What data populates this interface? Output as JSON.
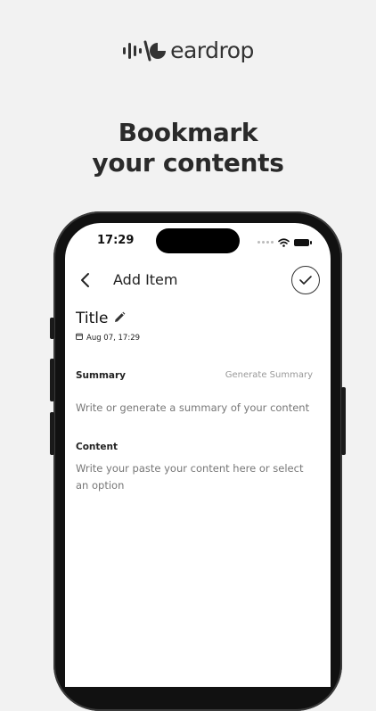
{
  "brand": {
    "name": "eardrop"
  },
  "headline": {
    "line1": "Bookmark",
    "line2": "your contents"
  },
  "status_bar": {
    "time": "17:29"
  },
  "nav": {
    "title": "Add Item"
  },
  "item": {
    "title": "Title",
    "date": "Aug 07, 17:29"
  },
  "summary": {
    "label": "Summary",
    "generate_label": "Generate Summary",
    "placeholder": "Write or generate a summary of your content"
  },
  "content": {
    "label": "Content",
    "placeholder": "Write your paste your content here or select an option"
  },
  "colors": {
    "background": "#f2f2f2",
    "phone_frame": "#111111",
    "screen": "#ffffff"
  }
}
